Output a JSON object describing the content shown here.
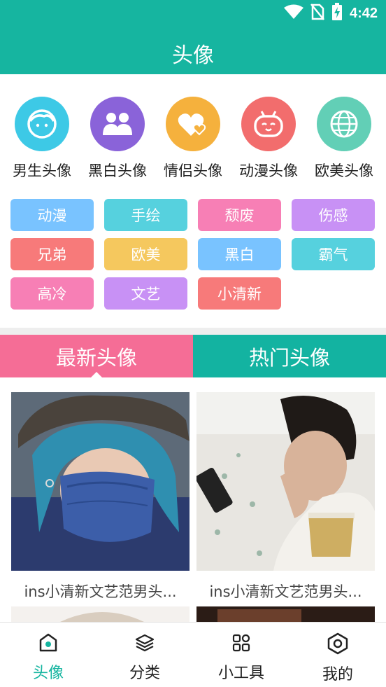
{
  "status": {
    "time": "4:42",
    "icons": [
      "wifi-icon",
      "no-sim-icon",
      "battery-charging-icon"
    ]
  },
  "header": {
    "title": "头像"
  },
  "categories": [
    {
      "label": "男生头像",
      "color": "#3dc9e6",
      "icon": "boy-face-icon"
    },
    {
      "label": "黑白头像",
      "color": "#8a63d9",
      "icon": "people-icon"
    },
    {
      "label": "情侣头像",
      "color": "#f5b13d",
      "icon": "hearts-icon"
    },
    {
      "label": "动漫头像",
      "color": "#f26d6d",
      "icon": "robot-face-icon"
    },
    {
      "label": "欧美头像",
      "color": "#62cfb6",
      "icon": "globe-icon"
    }
  ],
  "tags": [
    {
      "label": "动漫",
      "color": "#79c3ff"
    },
    {
      "label": "手绘",
      "color": "#56d1de"
    },
    {
      "label": "颓废",
      "color": "#f77fb5"
    },
    {
      "label": "伤感",
      "color": "#c891f5"
    },
    {
      "label": "兄弟",
      "color": "#f77a7a"
    },
    {
      "label": "欧美",
      "color": "#f5c85e"
    },
    {
      "label": "黑白",
      "color": "#79c3ff"
    },
    {
      "label": "霸气",
      "color": "#56d1de"
    },
    {
      "label": "高冷",
      "color": "#f77fb5"
    },
    {
      "label": "文艺",
      "color": "#c891f5"
    },
    {
      "label": "小清新",
      "color": "#f77a7a"
    }
  ],
  "tabs": {
    "latest": "最新头像",
    "hot": "热门头像"
  },
  "feed": [
    {
      "caption": "ins小清新文艺范男头..."
    },
    {
      "caption": "ins小清新文艺范男头..."
    }
  ],
  "nav": [
    {
      "label": "头像",
      "icon": "home-icon",
      "active": true
    },
    {
      "label": "分类",
      "icon": "layers-icon",
      "active": false
    },
    {
      "label": "小工具",
      "icon": "grid-tools-icon",
      "active": false
    },
    {
      "label": "我的",
      "icon": "hexagon-profile-icon",
      "active": false
    }
  ],
  "colors": {
    "primary": "#16b5a0",
    "pink": "#f56d96",
    "teal": "#13b3a1"
  }
}
